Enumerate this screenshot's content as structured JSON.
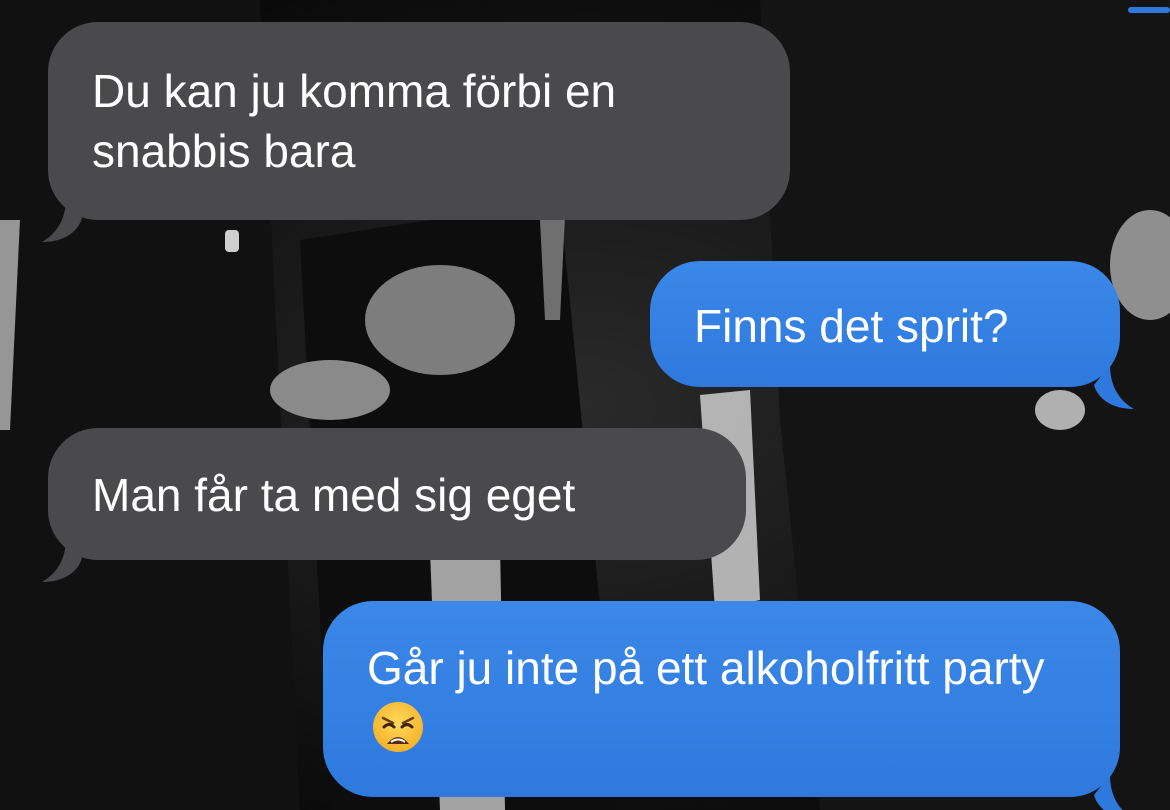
{
  "messages": [
    {
      "direction": "received",
      "text": "Du kan ju komma förbi en snabbis bara"
    },
    {
      "direction": "sent",
      "text": "Finns det sprit?"
    },
    {
      "direction": "received",
      "text": "Man får ta med sig eget"
    },
    {
      "direction": "sent",
      "text": "Går ju inte på ett alkoholfritt party",
      "emoji": "weary-face-emoji"
    }
  ],
  "colors": {
    "received_bubble": "#4a4a4c",
    "sent_bubble": "#2f79de",
    "text": "#ffffff",
    "background": "#0b0b0b"
  }
}
